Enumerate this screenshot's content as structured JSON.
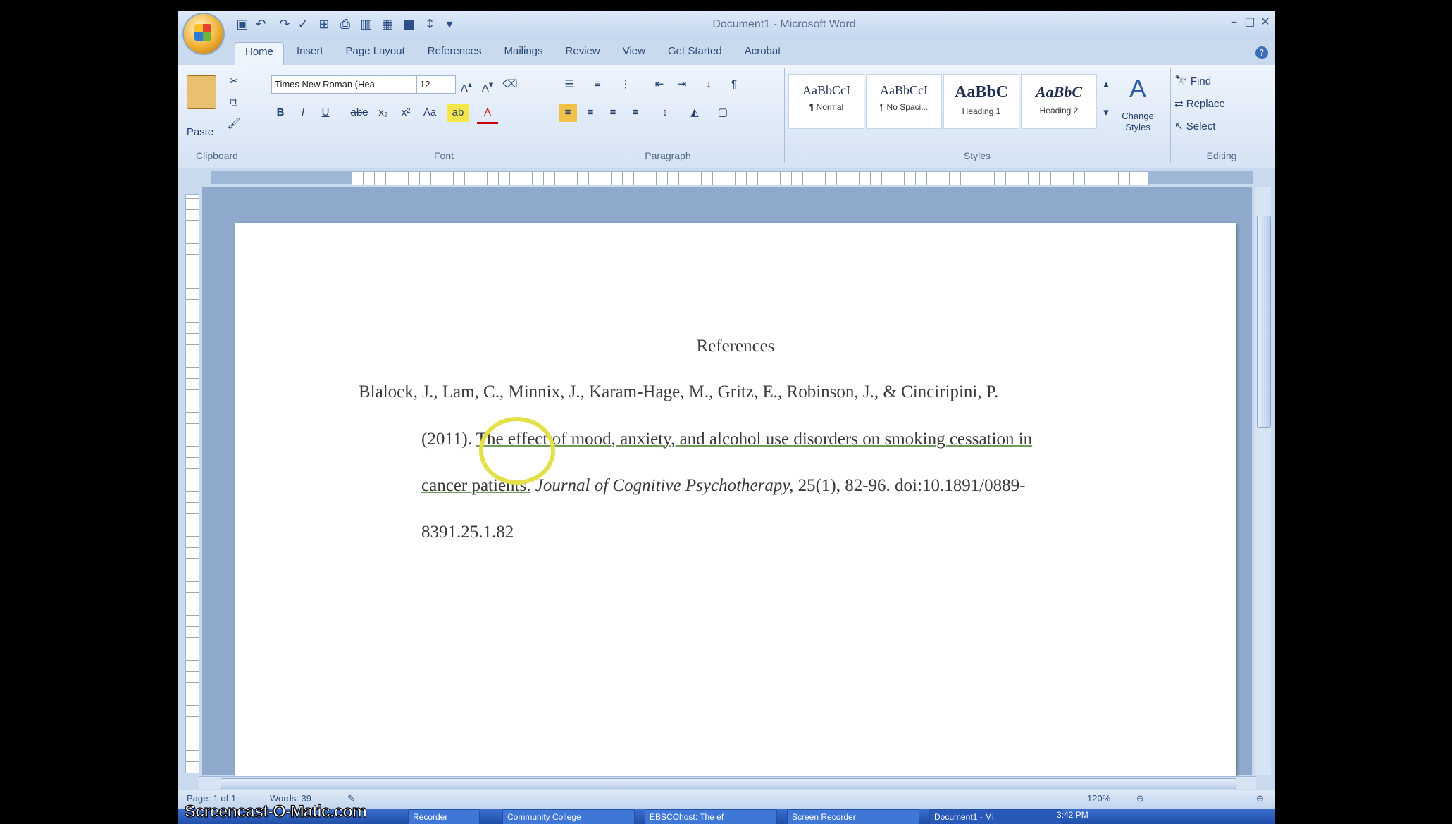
{
  "window": {
    "title": "Document1 - Microsoft Word"
  },
  "ribbon_tabs": [
    "Home",
    "Insert",
    "Page Layout",
    "References",
    "Mailings",
    "Review",
    "View",
    "Get Started",
    "Acrobat"
  ],
  "clipboard": {
    "paste_label": "Paste",
    "group": "Clipboard"
  },
  "font": {
    "name": "Times New Roman (Hea",
    "size": "12",
    "group": "Font"
  },
  "paragraph": {
    "group": "Paragraph"
  },
  "styles": {
    "group": "Styles",
    "items": [
      {
        "sample": "AaBbCcI",
        "name": "¶ Normal"
      },
      {
        "sample": "AaBbCcI",
        "name": "¶ No Spaci..."
      },
      {
        "sample": "AaBbC",
        "name": "Heading 1"
      },
      {
        "sample": "AaBbC",
        "name": "Heading 2"
      }
    ],
    "change_styles": "Change Styles"
  },
  "editing": {
    "group": "Editing",
    "find": "Find",
    "replace": "Replace",
    "select": "Select"
  },
  "document": {
    "heading": "References",
    "line1": "Blalock, J., Lam, C., Minnix, J., Karam-Hage, M., Gritz, E., Robinson, J., & Cinciripini, P.",
    "line2_prefix": "(2011). ",
    "line2_link": "The effect of mood, anxiety, and alcohol use disorders on smoking cessation in",
    "line3_link": "cancer patients.",
    "line3_journal": " Journal of Cognitive Psychotherapy,",
    "line3_rest": " 25(1), 82-96. doi:10.1891/0889-",
    "line4": "8391.25.1.82"
  },
  "status_bar": {
    "page": "Page: 1 of 1",
    "words": "Words: 39",
    "zoom": "120%"
  },
  "taskbar": {
    "watermark": "Screencast-O-Matic.com",
    "items": [
      "Recorder",
      "Community College",
      "EBSCOhost: The ef",
      "Screen Recorder",
      "Document1 - Mi"
    ],
    "clock": "3:42 PM"
  }
}
